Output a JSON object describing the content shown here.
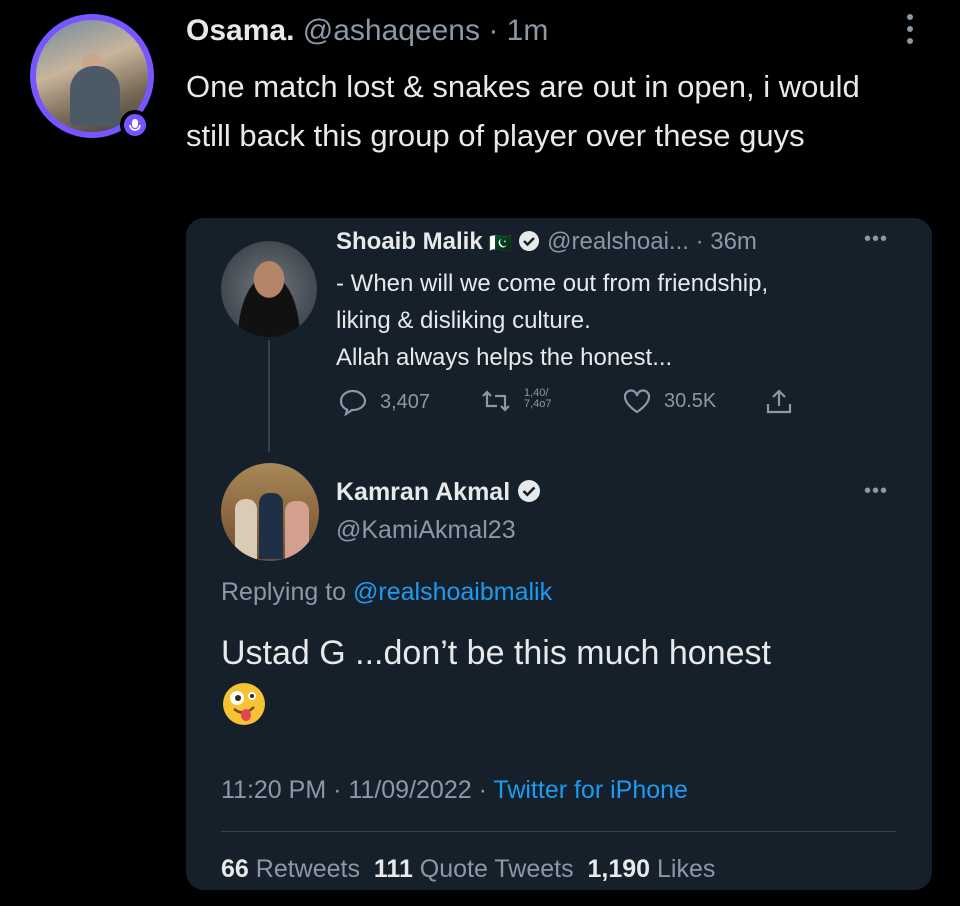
{
  "outer_tweet": {
    "name": "Osama.",
    "handle": "@ashaqeens",
    "time": "1m",
    "text": "One match lost & snakes are out in open, i would still back this group of player over these guys"
  },
  "quoted_thread": {
    "first": {
      "name": "Shoaib Malik",
      "flag": "🇵🇰",
      "handle": "@realshoai...",
      "time": "36m",
      "text_lines": [
        "- When will we come out from friendship,",
        "liking & disliking culture.",
        "Allah always helps the honest..."
      ],
      "replies": "3,407",
      "retweets_top": "1,40/",
      "retweets_bottom": "7,4o7",
      "likes": "30.5K"
    },
    "reply": {
      "name": "Kamran Akmal",
      "handle": "@KamiAkmal23",
      "replying_prefix": "Replying to",
      "replying_handle": "@realshoaibmalik",
      "text": "Ustad G ...don’t be this much honest",
      "emoji": "🤪",
      "time": "11:20 PM",
      "date": "11/09/2022",
      "source": "Twitter for iPhone",
      "retweets_count": "66",
      "retweets_label": "Retweets",
      "quotes_count": "111",
      "quotes_label": "Quote Tweets",
      "likes_count": "1,190",
      "likes_label": "Likes"
    }
  },
  "colors": {
    "background": "#000000",
    "card": "#15202b",
    "accent": "#1d9bf0",
    "space_ring": "#7856ff",
    "muted": "#8b98a5"
  }
}
